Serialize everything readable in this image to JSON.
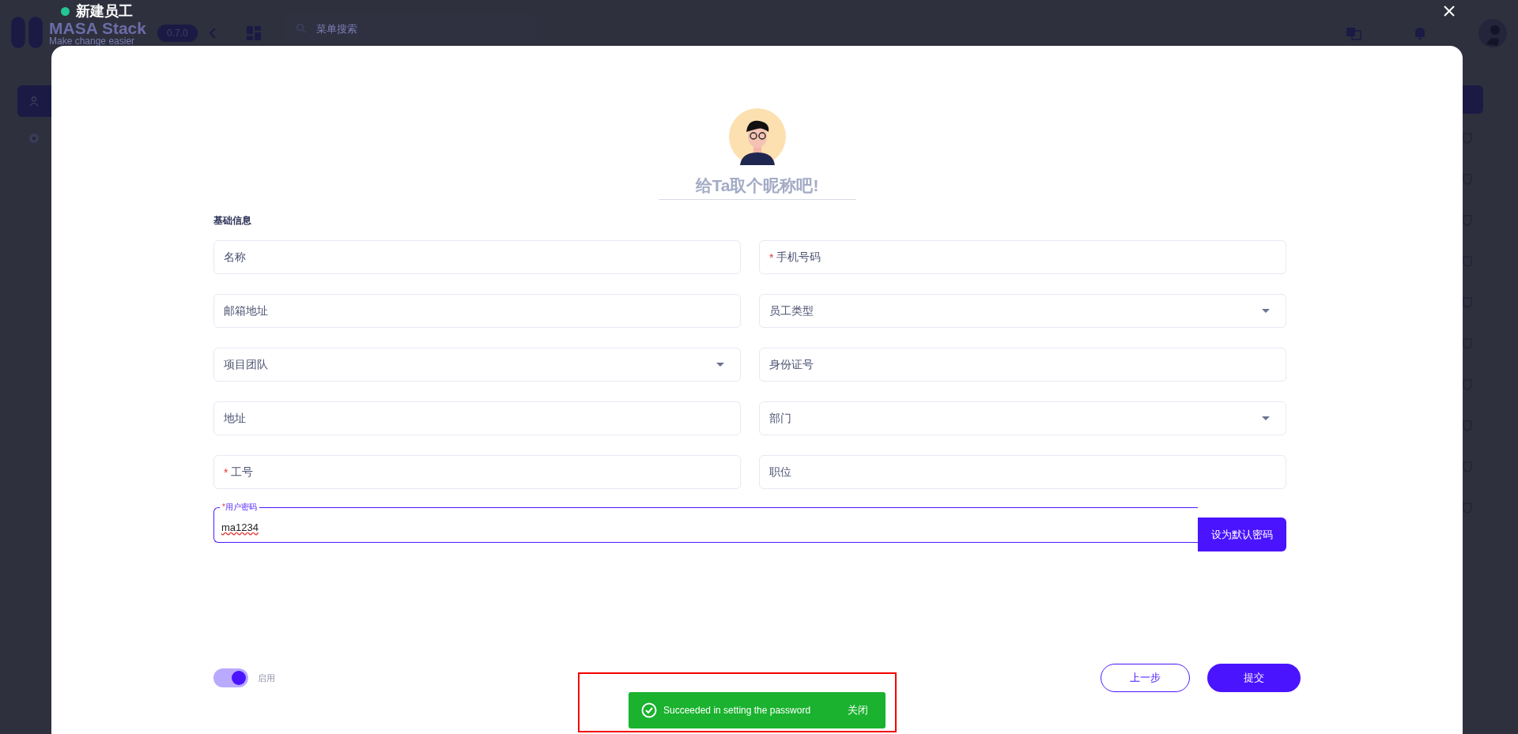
{
  "background_app": {
    "logo": "MASA Stack",
    "tagline": "Make change easier",
    "version": "0.7.0",
    "search": {
      "placeholder": "菜单搜索"
    }
  },
  "dialog": {
    "title": "新建员工",
    "nickname": {
      "placeholder": "给Ta取个昵称吧!"
    },
    "section_title": "基础信息",
    "fields": [
      {
        "label": "名称",
        "kind": "text"
      },
      {
        "label": "手机号码",
        "kind": "text",
        "mark": "*"
      },
      {
        "label": "邮箱地址",
        "kind": "text"
      },
      {
        "label": "员工类型",
        "kind": "select"
      },
      {
        "label": "项目团队",
        "kind": "select"
      },
      {
        "label": "身份证号",
        "kind": "text"
      },
      {
        "label": "地址",
        "kind": "text"
      },
      {
        "label": "部门",
        "kind": "select"
      },
      {
        "label": "工号",
        "kind": "text",
        "mark": "*"
      },
      {
        "label": "职位",
        "kind": "text"
      }
    ],
    "password": {
      "label": "用户密码",
      "mark": "*",
      "value": "ma1234",
      "action": "设为默认密码"
    },
    "enabled": {
      "label": "启用",
      "on": true
    },
    "buttons": [
      {
        "label": "上一步",
        "kind": "outline"
      },
      {
        "label": "提交",
        "kind": "primary"
      }
    ]
  },
  "toast": {
    "message": "Succeeded in setting the password",
    "action": "关闭"
  }
}
